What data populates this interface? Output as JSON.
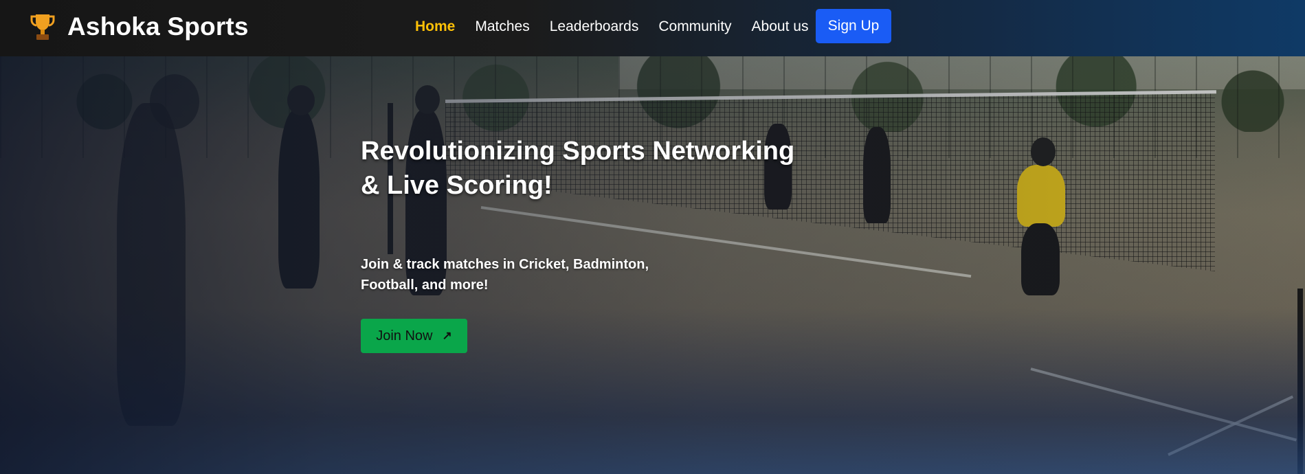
{
  "header": {
    "brand": "Ashoka Sports",
    "nav": [
      {
        "label": "Home",
        "active": true
      },
      {
        "label": "Matches",
        "active": false
      },
      {
        "label": "Leaderboards",
        "active": false
      },
      {
        "label": "Community",
        "active": false
      },
      {
        "label": "About us",
        "active": false
      }
    ],
    "signup_label": "Sign Up"
  },
  "hero": {
    "title_line1": "Revolutionizing Sports Networking",
    "title_line2": "& Live Scoring!",
    "subtitle_line1": "Join & track matches in Cricket, Badminton,",
    "subtitle_line2": "Football, and more!",
    "cta_label": "Join Now",
    "cta_icon": "arrow-up-right-icon"
  },
  "colors": {
    "active_nav": "#ffc107",
    "signup_button": "#1a5cf5",
    "cta_button": "#0aa64a",
    "trophy": "#f0a020"
  },
  "icons": {
    "brand": "trophy-icon"
  }
}
